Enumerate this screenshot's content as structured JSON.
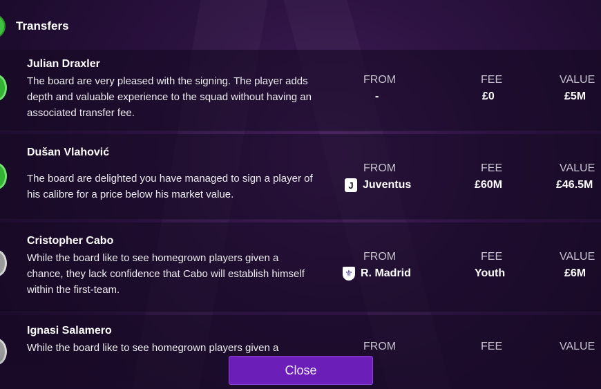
{
  "section": {
    "title": "Transfers"
  },
  "columns": {
    "from": "FROM",
    "fee": "FEE",
    "value": "VALUE"
  },
  "transfers": [
    {
      "name": "Julian Draxler",
      "comment": "The board are very pleased with the signing. The player adds depth and valuable experience to the squad without having an associated transfer fee.",
      "status": "green",
      "from": "-",
      "from_badge": "",
      "fee": "£0",
      "value": "£5M"
    },
    {
      "name": "Dušan Vlahović",
      "comment": "The board are delighted you have managed to sign a player of his calibre for a price below his market value.",
      "status": "green",
      "from": "Juventus",
      "from_badge": "J",
      "fee": "£60M",
      "value": "£46.5M"
    },
    {
      "name": "Cristopher Cabo",
      "comment": "While the board like to see homegrown players given a chance, they lack confidence that Cabo will establish himself within the first-team.",
      "status": "grey",
      "from": "R. Madrid",
      "from_badge": "⚜",
      "fee": "Youth",
      "value": "£6M"
    },
    {
      "name": "Ignasi Salamero",
      "comment": "While the board like to see homegrown players given a",
      "status": "grey",
      "from": "",
      "from_badge": "",
      "fee": "",
      "value": ""
    }
  ],
  "colors": {
    "accent": "#6b1fb8",
    "positive": "#34b234",
    "neutral": "#9a9a9a"
  },
  "icons": {
    "club_badge_juventus": "juventus-badge-icon",
    "club_badge_madrid": "real-madrid-badge-icon"
  },
  "footer": {
    "close_label": "Close"
  }
}
